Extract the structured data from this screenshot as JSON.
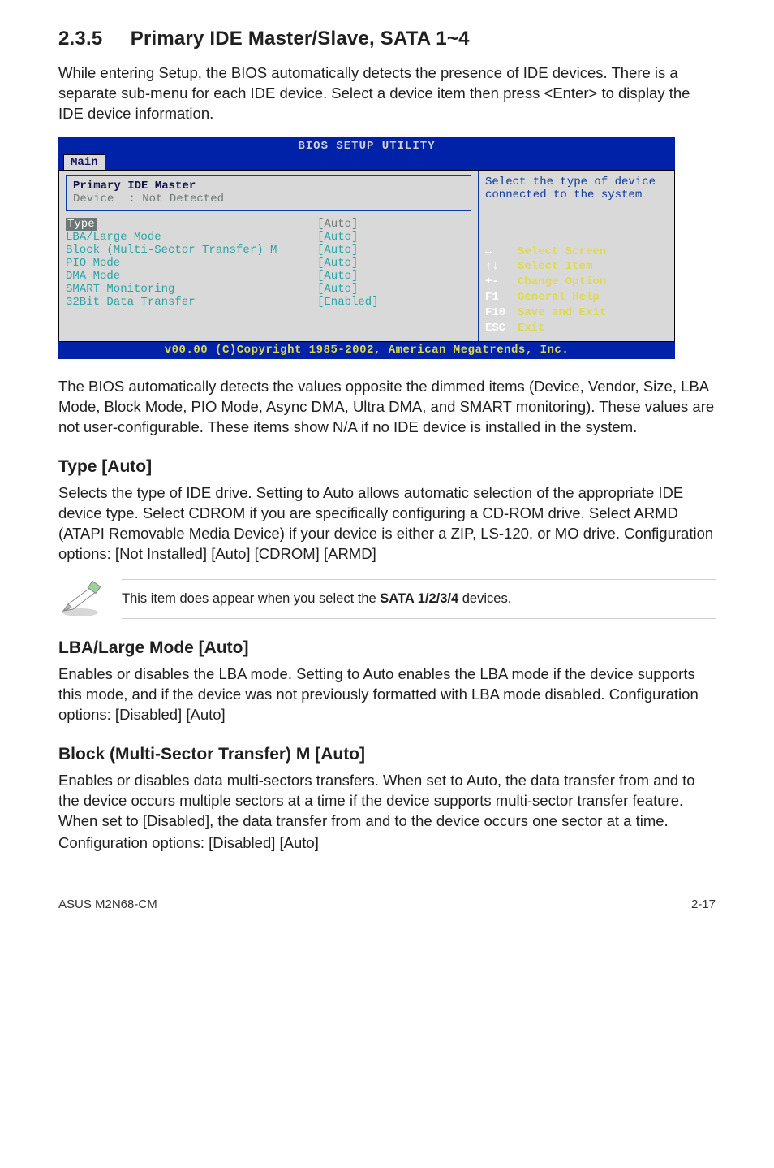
{
  "section": {
    "number": "2.3.5",
    "title": "Primary IDE Master/Slave, SATA 1~4",
    "intro": "While entering Setup, the BIOS automatically detects the presence of IDE devices. There is a separate sub-menu for each IDE device. Select a device item then press <Enter> to display the IDE device information."
  },
  "bios": {
    "title": "BIOS SETUP UTILITY",
    "tab": "Main",
    "panel_header": "Primary IDE Master",
    "panel_device_label": "Device",
    "panel_device_value": ": Not Detected",
    "rows": [
      {
        "label": "Type",
        "value": "[Auto]",
        "first": true
      },
      {
        "label": "LBA/Large Mode",
        "value": "[Auto]"
      },
      {
        "label": "Block (Multi-Sector Transfer) M",
        "value": "[Auto]"
      },
      {
        "label": "PIO Mode",
        "value": "[Auto]"
      },
      {
        "label": "DMA Mode",
        "value": "[Auto]"
      },
      {
        "label": "SMART Monitoring",
        "value": "[Auto]"
      },
      {
        "label": "32Bit Data Transfer",
        "value": "[Enabled]"
      }
    ],
    "help_top": "Select the type of device connected to the system",
    "keys": [
      {
        "k": "↔",
        "d": "Select Screen"
      },
      {
        "k": "↑↓",
        "d": "Select Item"
      },
      {
        "k": "+-",
        "d": "Change Option"
      },
      {
        "k": "F1",
        "d": "General Help"
      },
      {
        "k": "F10",
        "d": "Save and Exit"
      },
      {
        "k": "ESC",
        "d": "Exit"
      }
    ],
    "footer": "v00.00 (C)Copyright 1985-2002, American Megatrends, Inc."
  },
  "after_bios": "The BIOS automatically detects the values opposite the dimmed items (Device, Vendor, Size, LBA Mode, Block Mode, PIO Mode, Async DMA, Ultra DMA, and SMART monitoring). These values are not user-configurable. These items show N/A if no IDE device is installed in the system.",
  "type": {
    "heading": "Type [Auto]",
    "body": "Selects the type of IDE drive. Setting to Auto allows automatic selection of the appropriate IDE device type. Select CDROM if you are specifically configuring a CD-ROM drive. Select ARMD (ATAPI Removable Media Device) if your device is either a ZIP, LS-120, or MO drive. Configuration options: [Not Installed] [Auto] [CDROM] [ARMD]"
  },
  "note": {
    "prefix": "This item does appear when you select the ",
    "bold": "SATA 1/2/3/4",
    "suffix": " devices."
  },
  "lba": {
    "heading": "LBA/Large Mode [Auto]",
    "body": "Enables or disables the LBA mode. Setting to Auto enables the LBA mode if the device supports this mode, and if the device was not previously formatted with LBA mode disabled. Configuration options: [Disabled] [Auto]"
  },
  "block": {
    "heading": "Block (Multi-Sector Transfer) M [Auto]",
    "body": "Enables or disables data multi-sectors transfers. When set to Auto, the data transfer from and to the device occurs multiple sectors at a time if the device supports multi-sector transfer feature. When set to [Disabled], the data transfer from and to the device occurs one sector at a time.",
    "body2": "Configuration options: [Disabled] [Auto]"
  },
  "footer": {
    "left": "ASUS M2N68-CM",
    "right": "2-17"
  }
}
